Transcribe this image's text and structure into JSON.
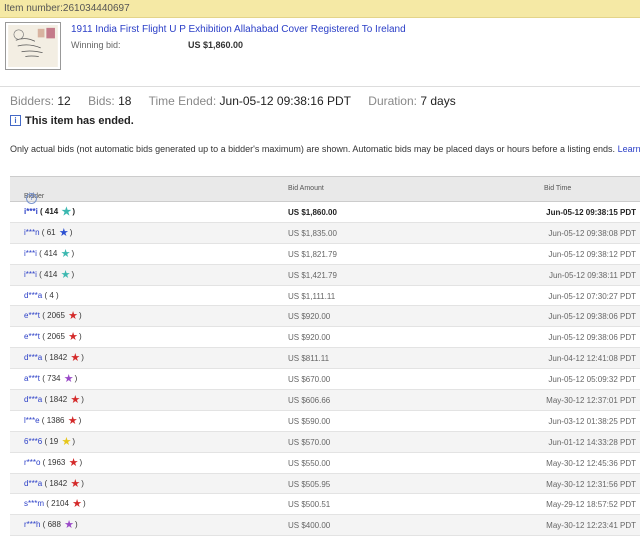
{
  "header": {
    "item_number_text": "Item number:261034440697"
  },
  "item": {
    "title": "1911 India First Flight U P Exhibition Allahabad Cover Registered To Ireland",
    "winning_label": "Winning bid:",
    "winning_value": "US $1,860.00"
  },
  "stats": {
    "bidders_label": "Bidders:",
    "bidders": "12",
    "bids_label": "Bids:",
    "bids": "18",
    "ended_label": "Time Ended:",
    "ended": "Jun-05-12 09:38:16 PDT",
    "duration_label": "Duration:",
    "duration": "7 days"
  },
  "ended_notice": "This item has ended.",
  "notice": {
    "text": "Only actual bids (not automatic bids generated up to a bidder's maximum) are shown. Automatic bids may be placed days or hours before a listing ends.",
    "link": "Learn"
  },
  "table": {
    "headers": {
      "bidder": "Bidder",
      "amount": "Bid Amount",
      "time": "Bid Time"
    },
    "rows": [
      {
        "user": "i***i",
        "rating": "414",
        "star": "teal",
        "amount": "US $1,860.00",
        "time": "Jun-05-12 09:38:15 PDT"
      },
      {
        "user": "i***n",
        "rating": "61",
        "star": "blue",
        "amount": "US $1,835.00",
        "time": "Jun-05-12 09:38:08 PDT"
      },
      {
        "user": "i***i",
        "rating": "414",
        "star": "teal",
        "amount": "US $1,821.79",
        "time": "Jun-05-12 09:38:12 PDT"
      },
      {
        "user": "i***i",
        "rating": "414",
        "star": "teal",
        "amount": "US $1,421.79",
        "time": "Jun-05-12 09:38:11 PDT"
      },
      {
        "user": "d***a",
        "rating": "4",
        "star": "",
        "amount": "US $1,111.11",
        "time": "Jun-05-12 07:30:27 PDT"
      },
      {
        "user": "e***t",
        "rating": "2065",
        "star": "red",
        "amount": "US $920.00",
        "time": "Jun-05-12 09:38:06 PDT"
      },
      {
        "user": "e***t",
        "rating": "2065",
        "star": "red",
        "amount": "US $920.00",
        "time": "Jun-05-12 09:38:06 PDT"
      },
      {
        "user": "d***a",
        "rating": "1842",
        "star": "red",
        "amount": "US $811.11",
        "time": "Jun-04-12 12:41:08 PDT"
      },
      {
        "user": "a***t",
        "rating": "734",
        "star": "purple",
        "amount": "US $670.00",
        "time": "Jun-05-12 05:09:32 PDT"
      },
      {
        "user": "d***a",
        "rating": "1842",
        "star": "red",
        "amount": "US $606.66",
        "time": "May-30-12 12:37:01 PDT"
      },
      {
        "user": "l***e",
        "rating": "1386",
        "star": "red",
        "amount": "US $590.00",
        "time": "Jun-03-12 01:38:25 PDT"
      },
      {
        "user": "6***6",
        "rating": "19",
        "star": "yellow",
        "amount": "US $570.00",
        "time": "Jun-01-12 14:33:28 PDT"
      },
      {
        "user": "r***o",
        "rating": "1963",
        "star": "red",
        "amount": "US $550.00",
        "time": "May-30-12 12:45:36 PDT"
      },
      {
        "user": "d***a",
        "rating": "1842",
        "star": "red",
        "amount": "US $505.95",
        "time": "May-30-12 12:31:56 PDT"
      },
      {
        "user": "s***m",
        "rating": "2104",
        "star": "red",
        "amount": "US $500.51",
        "time": "May-29-12 18:57:52 PDT"
      },
      {
        "user": "r***h",
        "rating": "688",
        "star": "purple",
        "amount": "US $400.00",
        "time": "May-30-12 12:23:41 PDT"
      }
    ]
  },
  "colors": {
    "link": "#2a3ec7",
    "teal": "#3cb8b0",
    "blue": "#2a4fd1",
    "red": "#d42a2a",
    "purple": "#9a49c8",
    "yellow": "#e6c619"
  }
}
